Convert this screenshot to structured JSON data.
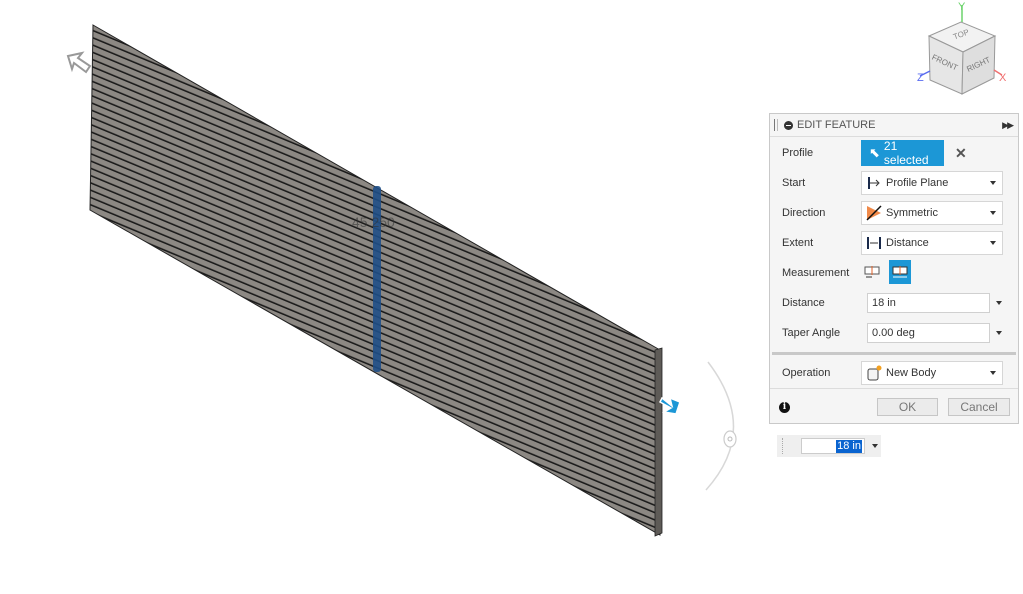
{
  "viewcube": {
    "faces": {
      "top": "TOP",
      "front": "FRONT",
      "right": "RIGHT"
    },
    "axes": {
      "y": "Y",
      "z": "Z",
      "x": "X"
    },
    "axis_colors": {
      "y": "#6cd36c",
      "z": "#5a6cf0",
      "x": "#f07070"
    }
  },
  "canvas": {
    "dimension_label": "45.250",
    "body_color": "#8c8883",
    "selection_color": "#1f4f87",
    "arrow_color": "#1c97d6"
  },
  "panel": {
    "title": "EDIT FEATURE",
    "expand_icon": "double-chevron-right",
    "rows": {
      "profile": {
        "label": "Profile",
        "value": "21 selected",
        "icon": "cursor-icon"
      },
      "start": {
        "label": "Start",
        "value": "Profile Plane",
        "icon": "profile-plane-icon"
      },
      "direction": {
        "label": "Direction",
        "value": "Symmetric",
        "icon": "symmetric-icon"
      },
      "extent": {
        "label": "Extent",
        "value": "Distance",
        "icon": "distance-icon"
      },
      "measurement": {
        "label": "Measurement",
        "options": [
          "half-length",
          "whole-length"
        ],
        "selected": "whole-length"
      },
      "distance": {
        "label": "Distance",
        "value": "18 in"
      },
      "taper": {
        "label": "Taper Angle",
        "value": "0.00 deg"
      },
      "operation": {
        "label": "Operation",
        "value": "New Body",
        "icon": "new-body-icon"
      }
    },
    "ok_label": "OK",
    "cancel_label": "Cancel",
    "accent": "#1c97d6"
  },
  "floating_input": {
    "value": "18 in"
  }
}
